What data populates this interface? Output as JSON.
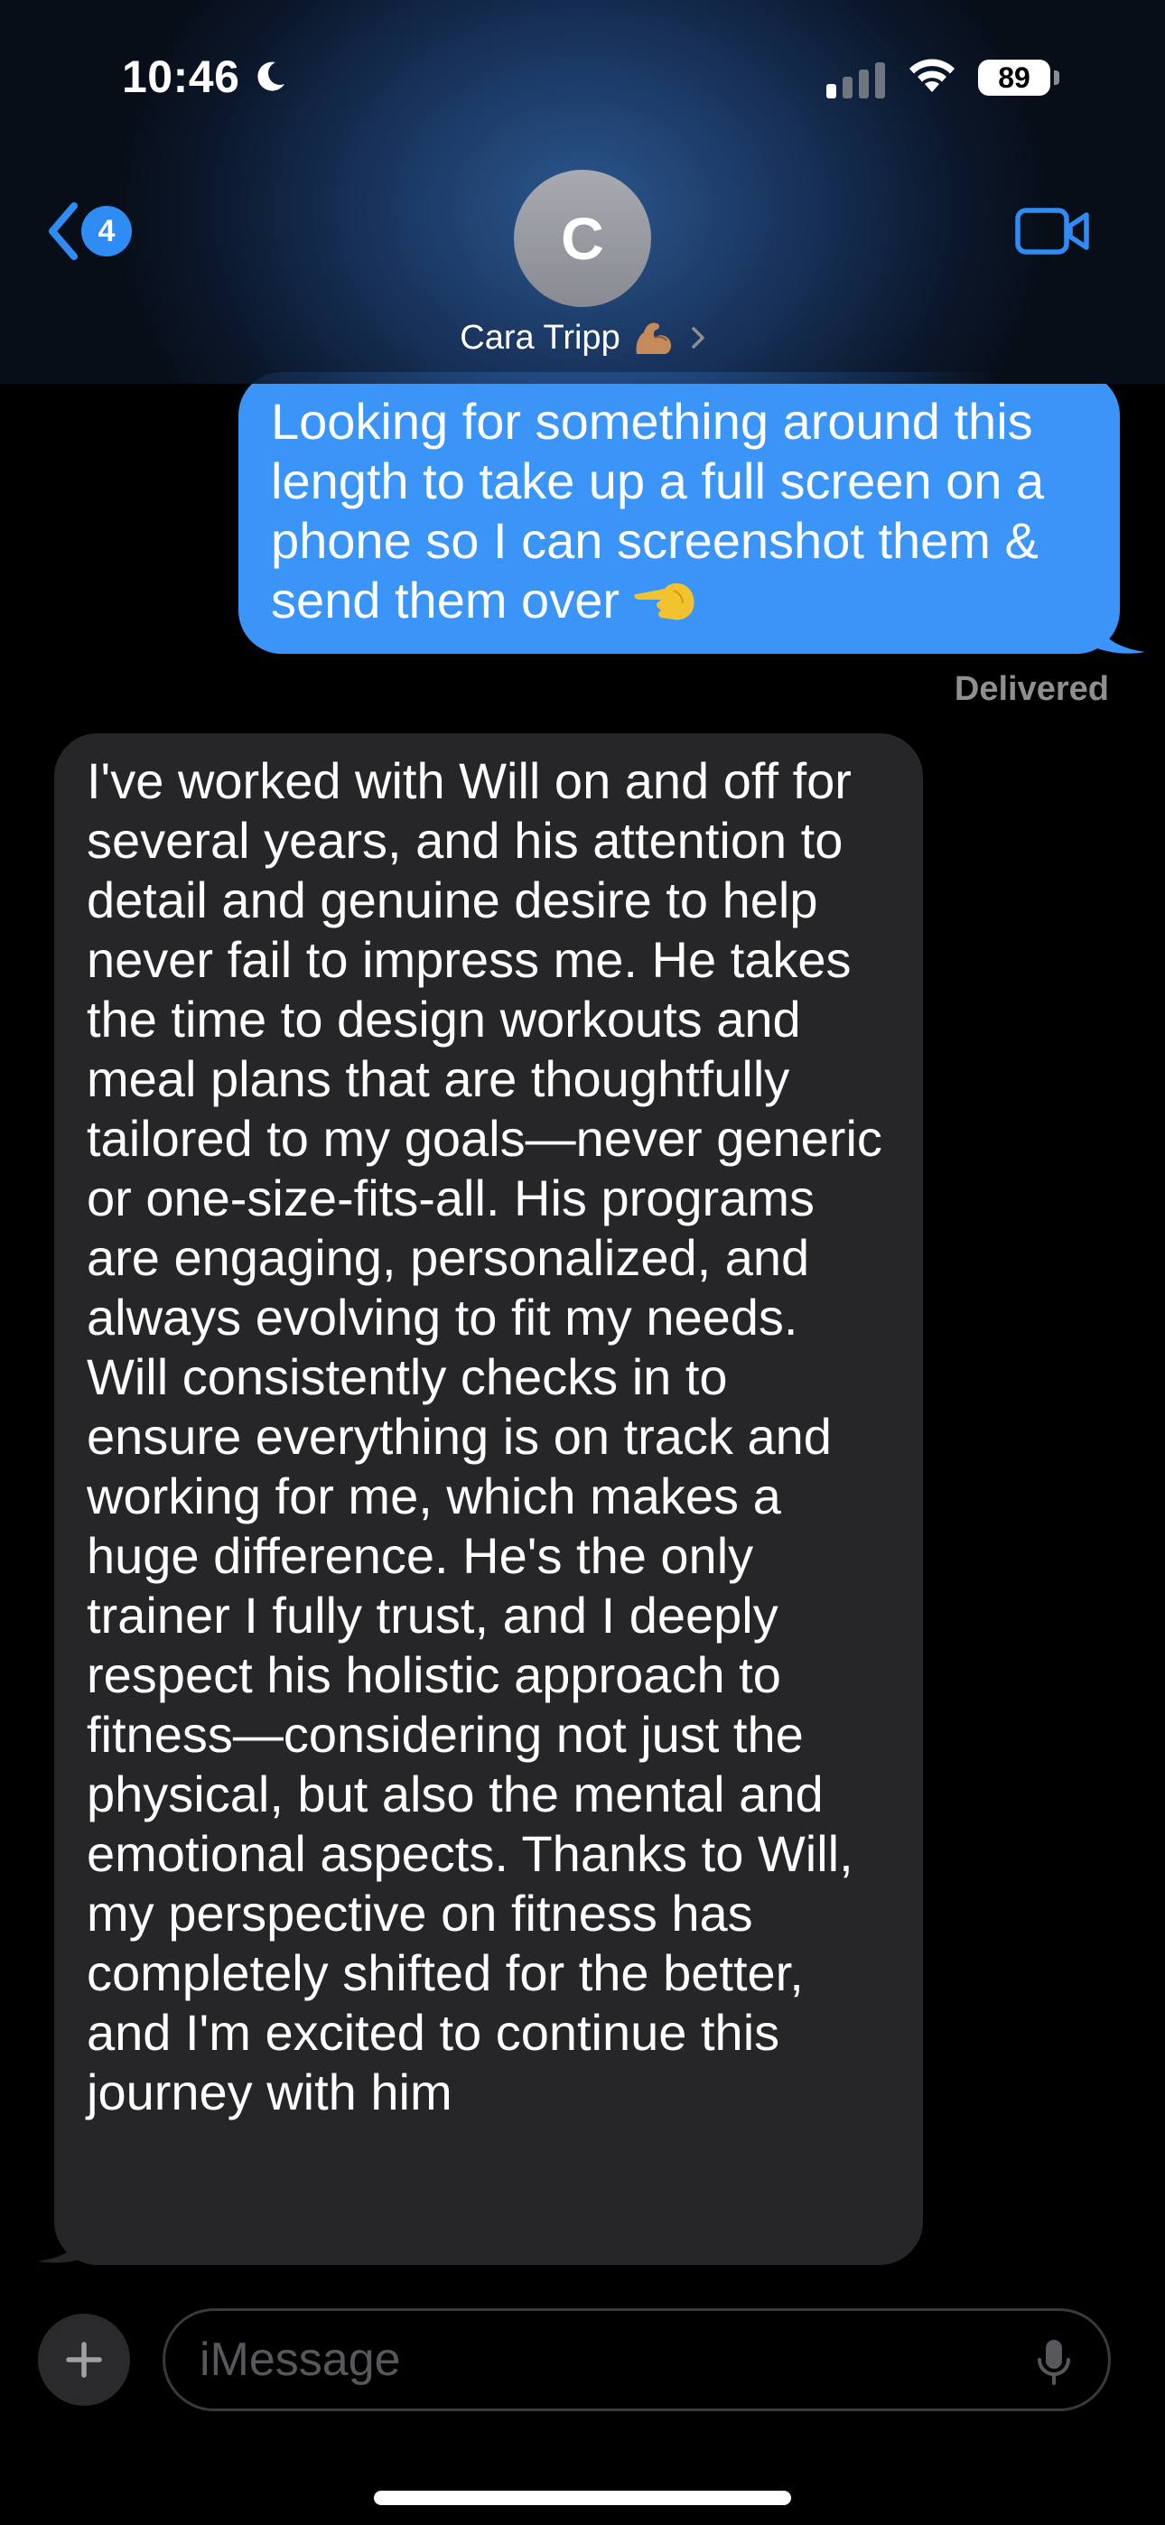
{
  "status_bar": {
    "time": "10:46",
    "focus_icon": "moon-icon",
    "battery_percent": "89",
    "signal_bars_active": 1,
    "signal_bars_total": 4
  },
  "header": {
    "back_badge_count": "4",
    "avatar_initial": "C",
    "contact_name": "Cara Tripp",
    "contact_emoji_icon": "flexed-biceps-icon",
    "video_icon": "video-camera-icon",
    "accent_color": "#2f8cf5"
  },
  "messages": {
    "outgoing": {
      "text": "Looking for something around this length to take up a full screen on a phone so I can screenshot them & send them over",
      "emoji_icon": "pointing-left-hand-icon",
      "status": "Delivered",
      "bubble_color": "#3b94f7"
    },
    "incoming": {
      "text": "I've worked with Will on and off for several years, and his attention to detail and genuine desire to help never fail to impress me. He takes the time to design workouts and meal plans that are thoughtfully tailored to my goals—never generic or one-size-fits-all. His programs are engaging, personalized, and always evolving to fit my needs. Will consistently checks in to ensure everything is on track and working for me, which makes a huge difference. He's the only trainer I fully trust, and I deeply respect his holistic approach to fitness—considering not just the physical, but also the mental and emotional aspects. Thanks to Will, my perspective on fitness has completely shifted for the better, and I'm excited to continue this journey with him",
      "bubble_color": "#262629"
    }
  },
  "composer": {
    "placeholder": "iMessage",
    "value": "",
    "plus_icon": "plus-icon",
    "mic_icon": "microphone-icon"
  }
}
